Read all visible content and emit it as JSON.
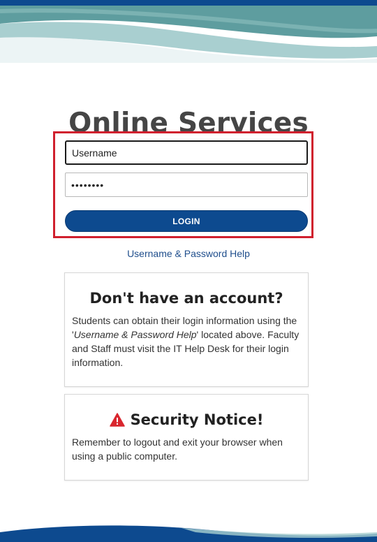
{
  "page": {
    "title": "Online Services"
  },
  "login": {
    "username_value": "Username",
    "password_value": "••••••••",
    "button_label": "LOGIN",
    "help_link": "Username & Password Help"
  },
  "account_card": {
    "title": "Don't have an account?",
    "text_before": "Students can obtain their login information using the '",
    "text_emphasis": "Username & Password Help",
    "text_after": "' located above. Faculty and Staff must visit the IT Help Desk for their login information."
  },
  "security_card": {
    "title": "Security Notice!",
    "icon": "warning-icon",
    "text": "Remember to logout and exit your browser when using a public computer."
  },
  "colors": {
    "brand_blue": "#0d4a8f",
    "teal": "#6fa9a8",
    "highlight_red": "#d0202e",
    "warning_red": "#d9262e"
  }
}
